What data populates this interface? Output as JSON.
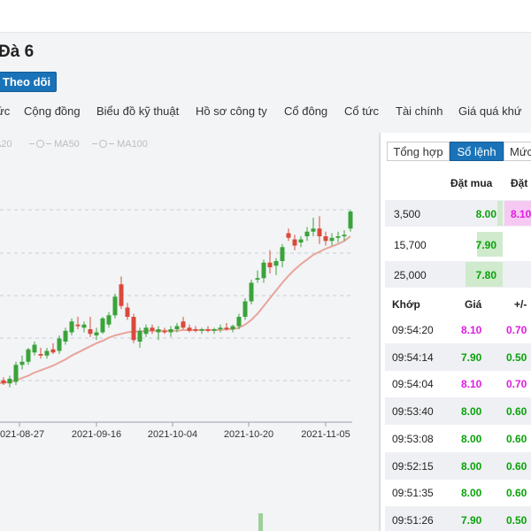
{
  "stock": {
    "title": "Đà 6",
    "follow_label": "Theo dõi"
  },
  "nav": {
    "items": [
      "ức",
      "Cộng đồng",
      "Biểu đồ kỹ thuật",
      "Hồ sơ công ty",
      "Cổ đông",
      "Cổ tức",
      "Tài chính",
      "Giá quá khứ"
    ]
  },
  "chart": {
    "legend": [
      {
        "label": "A20",
        "icon": "circle-icon"
      },
      {
        "label": "MA50",
        "icon": "circle-icon"
      },
      {
        "label": "MA100",
        "icon": "circle-icon"
      }
    ],
    "colors": {
      "up": "#3aa33a",
      "down": "#d94a3a",
      "ma": "#e8a49a",
      "grid": "#c9ced3"
    }
  },
  "chart_data": {
    "type": "candlestick",
    "x_ticks": [
      "2021-08-27",
      "2021-09-16",
      "2021-10-04",
      "2021-10-20",
      "2021-11-05"
    ],
    "candles": [
      {
        "o": 6.62,
        "h": 6.66,
        "l": 6.58,
        "c": 6.64
      },
      {
        "o": 6.64,
        "h": 6.68,
        "l": 6.58,
        "c": 6.6
      },
      {
        "o": 6.6,
        "h": 6.7,
        "l": 6.55,
        "c": 6.66
      },
      {
        "o": 6.62,
        "h": 6.88,
        "l": 6.58,
        "c": 6.84
      },
      {
        "o": 6.84,
        "h": 6.96,
        "l": 6.78,
        "c": 6.88
      },
      {
        "o": 6.88,
        "h": 7.06,
        "l": 6.84,
        "c": 7.04
      },
      {
        "o": 7.0,
        "h": 7.14,
        "l": 6.96,
        "c": 7.1
      },
      {
        "o": 6.98,
        "h": 7.06,
        "l": 6.92,
        "c": 6.96
      },
      {
        "o": 6.96,
        "h": 7.06,
        "l": 6.92,
        "c": 7.02
      },
      {
        "o": 7.04,
        "h": 7.12,
        "l": 6.98,
        "c": 7.0
      },
      {
        "o": 7.02,
        "h": 7.22,
        "l": 6.98,
        "c": 7.18
      },
      {
        "o": 7.14,
        "h": 7.32,
        "l": 7.1,
        "c": 7.28
      },
      {
        "o": 7.26,
        "h": 7.44,
        "l": 7.22,
        "c": 7.4
      },
      {
        "o": 7.36,
        "h": 7.46,
        "l": 7.3,
        "c": 7.34
      },
      {
        "o": 7.32,
        "h": 7.4,
        "l": 7.26,
        "c": 7.36
      },
      {
        "o": 7.3,
        "h": 7.46,
        "l": 7.2,
        "c": 7.24
      },
      {
        "o": 7.22,
        "h": 7.32,
        "l": 7.16,
        "c": 7.26
      },
      {
        "o": 7.26,
        "h": 7.46,
        "l": 7.24,
        "c": 7.44
      },
      {
        "o": 7.36,
        "h": 7.52,
        "l": 7.32,
        "c": 7.48
      },
      {
        "o": 7.48,
        "h": 7.76,
        "l": 7.44,
        "c": 7.72
      },
      {
        "o": 7.88,
        "h": 7.98,
        "l": 7.56,
        "c": 7.6
      },
      {
        "o": 7.58,
        "h": 7.64,
        "l": 7.42,
        "c": 7.46
      },
      {
        "o": 7.46,
        "h": 7.5,
        "l": 7.12,
        "c": 7.16
      },
      {
        "o": 7.14,
        "h": 7.32,
        "l": 7.06,
        "c": 7.28
      },
      {
        "o": 7.24,
        "h": 7.36,
        "l": 7.2,
        "c": 7.32
      },
      {
        "o": 7.32,
        "h": 7.36,
        "l": 7.24,
        "c": 7.28
      },
      {
        "o": 7.26,
        "h": 7.34,
        "l": 7.16,
        "c": 7.3
      },
      {
        "o": 7.28,
        "h": 7.32,
        "l": 7.24,
        "c": 7.26
      },
      {
        "o": 7.26,
        "h": 7.34,
        "l": 7.2,
        "c": 7.3
      },
      {
        "o": 7.3,
        "h": 7.38,
        "l": 7.26,
        "c": 7.34
      },
      {
        "o": 7.4,
        "h": 7.46,
        "l": 7.3,
        "c": 7.32
      },
      {
        "o": 7.32,
        "h": 7.36,
        "l": 7.26,
        "c": 7.28
      },
      {
        "o": 7.3,
        "h": 7.34,
        "l": 7.26,
        "c": 7.28
      },
      {
        "o": 7.28,
        "h": 7.32,
        "l": 7.24,
        "c": 7.3
      },
      {
        "o": 7.3,
        "h": 7.34,
        "l": 7.26,
        "c": 7.28
      },
      {
        "o": 7.28,
        "h": 7.32,
        "l": 7.24,
        "c": 7.3
      },
      {
        "o": 7.3,
        "h": 7.36,
        "l": 7.26,
        "c": 7.32
      },
      {
        "o": 7.32,
        "h": 7.38,
        "l": 7.28,
        "c": 7.3
      },
      {
        "o": 7.3,
        "h": 7.36,
        "l": 7.26,
        "c": 7.34
      },
      {
        "o": 7.34,
        "h": 7.5,
        "l": 7.3,
        "c": 7.46
      },
      {
        "o": 7.46,
        "h": 7.7,
        "l": 7.42,
        "c": 7.66
      },
      {
        "o": 7.66,
        "h": 7.94,
        "l": 7.62,
        "c": 7.9
      },
      {
        "o": 7.94,
        "h": 8.06,
        "l": 7.9,
        "c": 7.96
      },
      {
        "o": 7.96,
        "h": 8.2,
        "l": 7.9,
        "c": 8.16
      },
      {
        "o": 8.16,
        "h": 8.32,
        "l": 8.02,
        "c": 8.1
      },
      {
        "o": 8.12,
        "h": 8.22,
        "l": 8.0,
        "c": 8.18
      },
      {
        "o": 8.18,
        "h": 8.4,
        "l": 8.1,
        "c": 8.36
      },
      {
        "o": 8.54,
        "h": 8.6,
        "l": 8.44,
        "c": 8.48
      },
      {
        "o": 8.46,
        "h": 8.52,
        "l": 8.32,
        "c": 8.38
      },
      {
        "o": 8.42,
        "h": 8.5,
        "l": 8.36,
        "c": 8.46
      },
      {
        "o": 8.5,
        "h": 8.62,
        "l": 8.44,
        "c": 8.56
      },
      {
        "o": 8.56,
        "h": 8.74,
        "l": 8.5,
        "c": 8.6
      },
      {
        "o": 8.6,
        "h": 8.76,
        "l": 8.4,
        "c": 8.5
      },
      {
        "o": 8.5,
        "h": 8.56,
        "l": 8.38,
        "c": 8.44
      },
      {
        "o": 8.44,
        "h": 8.54,
        "l": 8.38,
        "c": 8.48
      },
      {
        "o": 8.48,
        "h": 8.56,
        "l": 8.42,
        "c": 8.5
      },
      {
        "o": 8.5,
        "h": 8.58,
        "l": 8.44,
        "c": 8.52
      },
      {
        "o": 8.6,
        "h": 8.84,
        "l": 8.56,
        "c": 8.82
      }
    ],
    "ma": [
      6.6,
      6.61,
      6.62,
      6.64,
      6.67,
      6.7,
      6.74,
      6.77,
      6.8,
      6.83,
      6.87,
      6.91,
      6.96,
      7.0,
      7.04,
      7.08,
      7.12,
      7.15,
      7.19,
      7.22,
      7.24,
      7.26,
      7.27,
      7.27,
      7.28,
      7.28,
      7.28,
      7.28,
      7.28,
      7.28,
      7.29,
      7.29,
      7.29,
      7.29,
      7.29,
      7.29,
      7.29,
      7.3,
      7.3,
      7.32,
      7.36,
      7.42,
      7.5,
      7.6,
      7.7,
      7.8,
      7.9,
      7.99,
      8.07,
      8.14,
      8.2,
      8.26,
      8.3,
      8.34,
      8.37,
      8.4,
      8.44,
      8.5
    ]
  },
  "right_panel": {
    "tabs": [
      "Tổng hợp",
      "Sổ lệnh",
      "Mức"
    ],
    "active_tab": "Sổ lệnh",
    "orderbook": {
      "headers": [
        "Đặt mua",
        "Đặt"
      ],
      "rows": [
        {
          "volume": "3,500",
          "bid": "8.00",
          "ask": "8.10",
          "bid_fill": 0.05,
          "ask_fill": 0.5
        },
        {
          "volume": "15,700",
          "bid": "7.90",
          "bid_fill": 0.22
        },
        {
          "volume": "25,000",
          "bid": "7.80",
          "bid_fill": 0.32
        }
      ]
    },
    "matched": {
      "headers": [
        "Khớp",
        "Giá",
        "+/-"
      ],
      "rows": [
        {
          "time": "09:54:20",
          "price": "8.10",
          "change": "0.70",
          "color": "magenta"
        },
        {
          "time": "09:54:14",
          "price": "7.90",
          "change": "0.50",
          "color": "green"
        },
        {
          "time": "09:54:04",
          "price": "8.10",
          "change": "0.70",
          "color": "magenta"
        },
        {
          "time": "09:53:40",
          "price": "8.00",
          "change": "0.60",
          "color": "green"
        },
        {
          "time": "09:53:08",
          "price": "8.00",
          "change": "0.60",
          "color": "green"
        },
        {
          "time": "09:52:15",
          "price": "8.00",
          "change": "0.60",
          "color": "green"
        },
        {
          "time": "09:51:35",
          "price": "8.00",
          "change": "0.60",
          "color": "green"
        },
        {
          "time": "09:51:26",
          "price": "7.90",
          "change": "0.50",
          "color": "green"
        }
      ]
    }
  }
}
